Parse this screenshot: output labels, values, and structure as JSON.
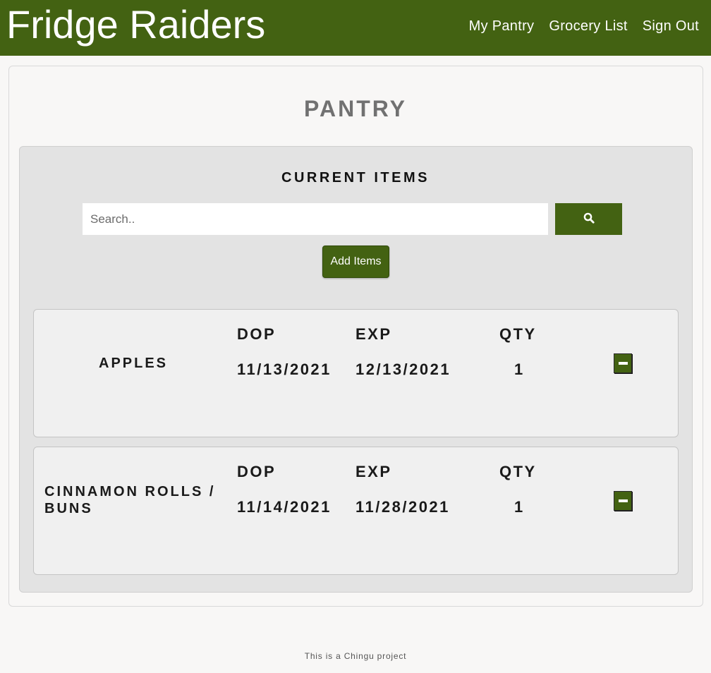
{
  "navbar": {
    "brand": "Fridge Raiders",
    "links": [
      "My Pantry",
      "Grocery List",
      "Sign Out"
    ]
  },
  "page": {
    "title": "PANTRY"
  },
  "current_items": {
    "title": "CURRENT ITEMS",
    "search_placeholder": "Search..",
    "add_button": "Add Items"
  },
  "columns": {
    "dop": "DOP",
    "exp": "EXP",
    "qty": "QTY"
  },
  "items": [
    {
      "name": "APPLES",
      "dop": "11/13/2021",
      "exp": "12/13/2021",
      "qty": "1"
    },
    {
      "name_line1": "CINNAMON ROLLS /",
      "name_line2": "BUNS",
      "dop": "11/14/2021",
      "exp": "11/28/2021",
      "qty": "1"
    }
  ],
  "footer": {
    "text": "This is a Chingu project"
  },
  "colors": {
    "brand_green": "#436212",
    "page_bg": "#f8f7f6",
    "panel_bg": "#e3e3e3",
    "card_bg": "#f0f0f0"
  },
  "icons": {
    "search": "search-icon",
    "remove": "minus-icon"
  }
}
